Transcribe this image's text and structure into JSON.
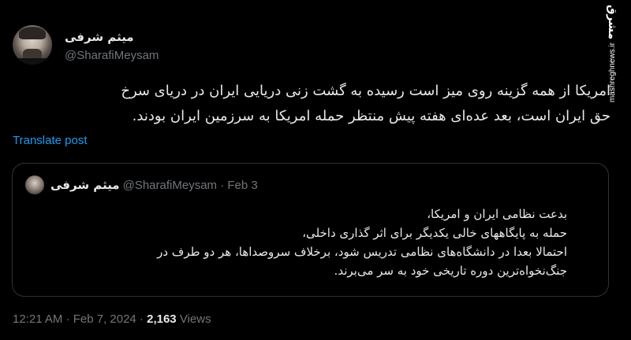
{
  "tweet": {
    "author_name": "میثم شرفی",
    "author_handle": "@SharafiMeysam",
    "text_line1": "امریکا از همه گزینه روی میز است رسیده به گشت زنی دریایی ایران در دریای سرخ",
    "text_line2": "حق ایران است، بعد عده‌ای هفته پیش منتظر حمله امریکا به سرزمین ایران بودند.",
    "translate_label": "Translate post"
  },
  "quoted": {
    "author_name": "میثم شرفی",
    "handle_date": "@SharafiMeysam · Feb 3",
    "lines": [
      "بدعت نظامی ایران و امریکا،",
      "حمله به پایگاههای خالی یکدیگر برای اثر گذاری داخلی،",
      "احتمالا بعدا در دانشگاه‌های نظامی تدریس شود، برخلاف سروصداها، هر دو طرف در",
      "جنگ‌نخواه‌ترین دوره تاریخی خود به سر می‌برند."
    ]
  },
  "footer": {
    "timestamp": "12:21 AM · Feb 7, 2024 · ",
    "views_count": "2,163",
    "views_label": " Views"
  },
  "watermark": {
    "logo": "مشرق",
    "site": "mashreghnews.ir"
  }
}
